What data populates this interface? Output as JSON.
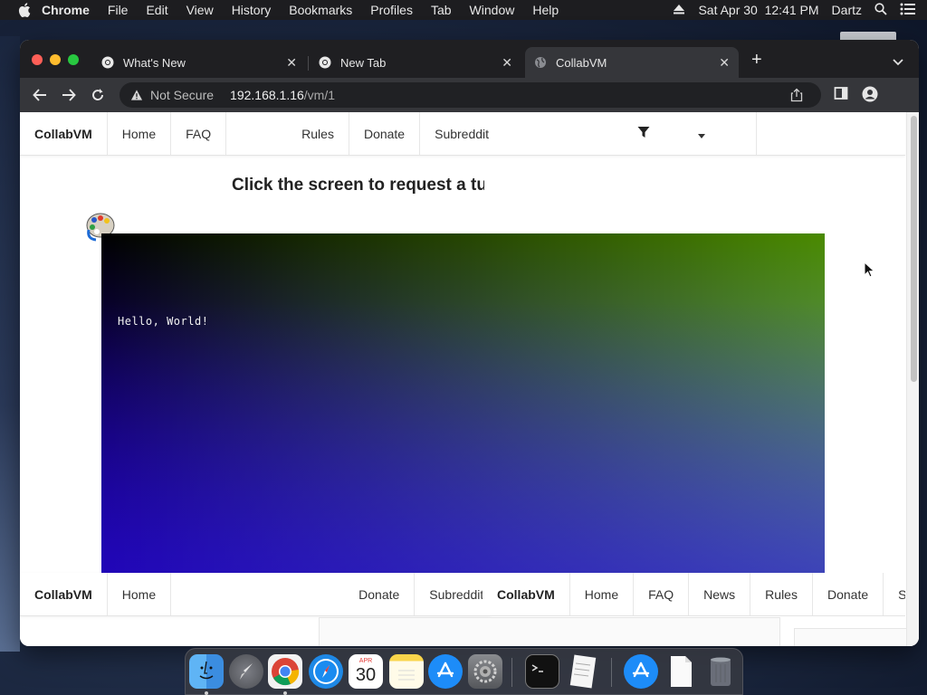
{
  "menubar": {
    "app": "Chrome",
    "items": [
      "File",
      "Edit",
      "View",
      "History",
      "Bookmarks",
      "Profiles",
      "Tab",
      "Window",
      "Help"
    ],
    "datetime": "Sat Apr 30  12:41 PM",
    "user": "Dartz"
  },
  "browser": {
    "tabs": [
      {
        "title": "What's New"
      },
      {
        "title": "New Tab"
      },
      {
        "title": "CollabVM"
      }
    ],
    "security_label": "Not Secure",
    "url_host": "192.168.1.16",
    "url_path": "/vm/1"
  },
  "page": {
    "nav_top": [
      "CollabVM",
      "Home",
      "FAQ",
      "Rules",
      "Donate",
      "Subreddit"
    ],
    "heading": "Click the screen to request a turn",
    "vm_text": "Hello, World!",
    "nav_bottom_a": [
      "CollabVM",
      "Home",
      "Donate",
      "Subreddit"
    ],
    "nav_bottom_b": [
      "CollabVM",
      "Home",
      "FAQ",
      "News",
      "Rules",
      "Donate",
      "Sul"
    ]
  },
  "dock": {
    "calendar_month": "APR",
    "calendar_day": "30"
  },
  "colors": {
    "vm_gradient_topright": "#4a8a00",
    "vm_gradient_bottomleft": "#2300c8",
    "chrome_dark": "#35363a"
  },
  "icons": [
    "apple-icon",
    "eject-icon",
    "search-icon",
    "control-center-icon",
    "chrome-icon",
    "globe-icon",
    "back-icon",
    "forward-icon",
    "reload-icon",
    "warning-icon",
    "share-icon",
    "sidebar-icon",
    "profile-icon",
    "filter-icon",
    "caret-down-icon",
    "palette-icon",
    "mouse-cursor-icon"
  ]
}
